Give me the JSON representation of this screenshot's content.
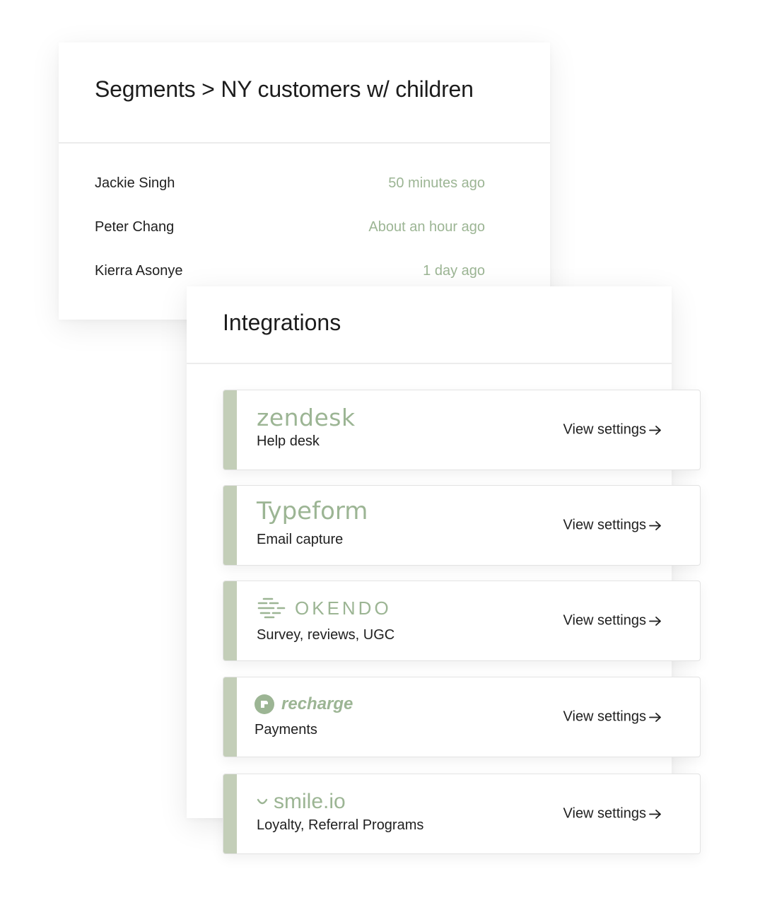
{
  "segments": {
    "title": "Segments > NY customers w/ children",
    "rows": [
      {
        "name": "Jackie Singh",
        "time": "50 minutes ago"
      },
      {
        "name": "Peter Chang",
        "time": "About an hour ago"
      },
      {
        "name": "Kierra Asonye",
        "time": "1 day ago"
      }
    ]
  },
  "integrations": {
    "title": "Integrations",
    "items": [
      {
        "logo_text": "zendesk",
        "logo_icon": "zendesk-wordmark",
        "description": "Help desk",
        "action": "View settings"
      },
      {
        "logo_text": "Typeform",
        "logo_icon": "typeform-wordmark",
        "description": "Email capture",
        "action": "View settings"
      },
      {
        "logo_text": "OKENDO",
        "logo_icon": "okendo-lines-icon",
        "description": "Survey, reviews, UGC",
        "action": "View settings"
      },
      {
        "logo_text": "recharge",
        "logo_icon": "recharge-badge-icon",
        "description": "Payments",
        "action": "View settings"
      },
      {
        "logo_text": "smile.io",
        "logo_icon": "smile-icon",
        "description": "Loyalty, Referral Programs",
        "action": "View settings"
      }
    ]
  },
  "colors": {
    "accent_green": "#9cb594",
    "accent_bar": "#c3ceb8",
    "text_dark": "#1f1f1f",
    "border": "#e3e3e3"
  }
}
